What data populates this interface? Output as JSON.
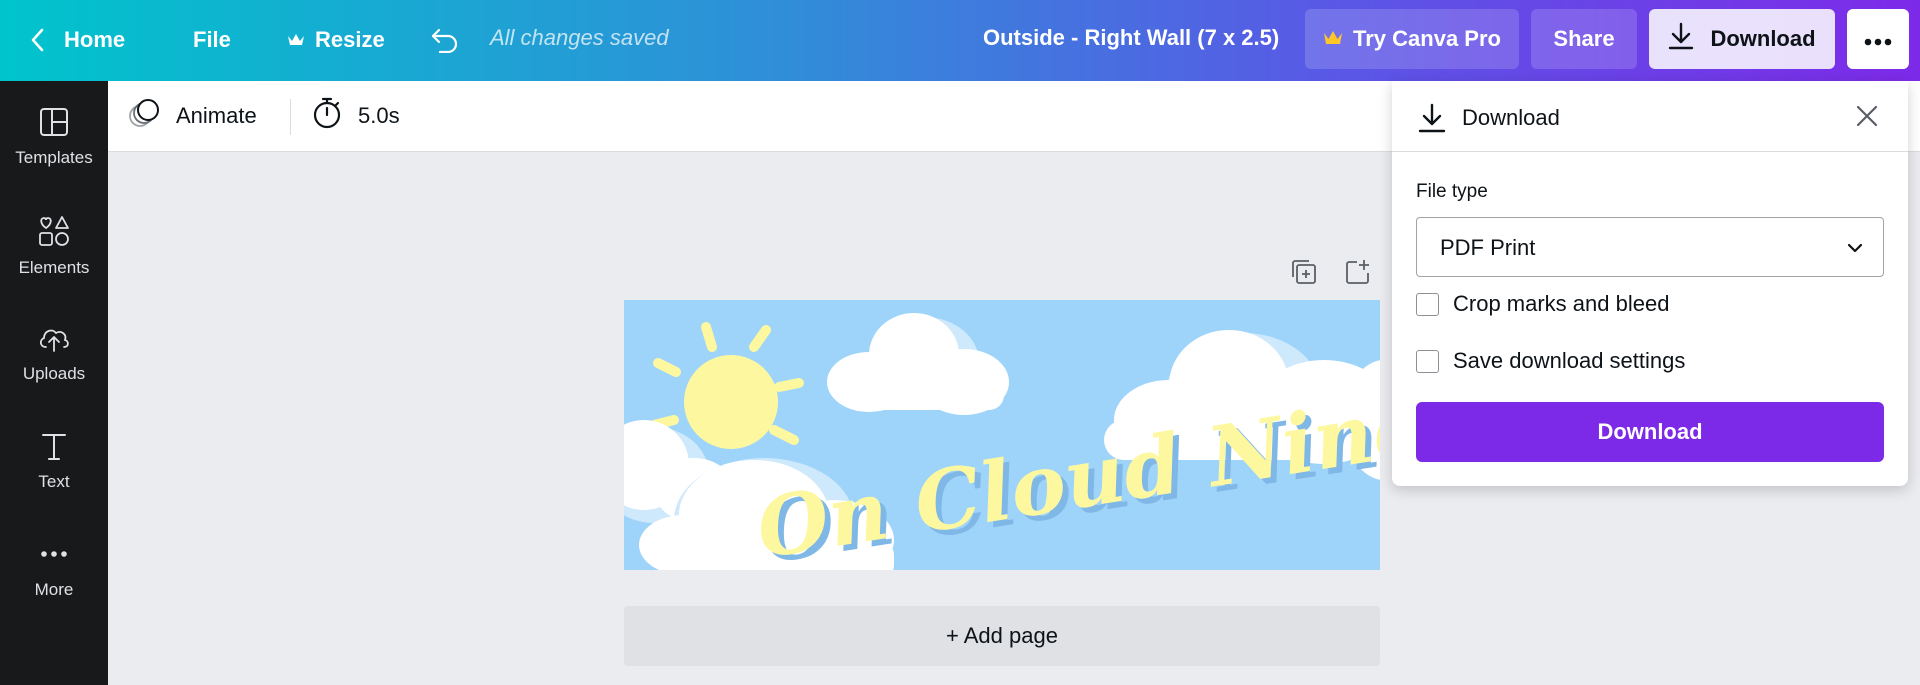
{
  "topbar": {
    "home_label": "Home",
    "file_label": "File",
    "resize_label": "Resize",
    "saved_status": "All changes saved",
    "document_title": "Outside - Right Wall (7 x 2.5)",
    "try_pro_label": "Try Canva Pro",
    "share_label": "Share",
    "download_label": "Download"
  },
  "sidebar": {
    "items": [
      {
        "label": "Templates",
        "icon": "templates-icon"
      },
      {
        "label": "Elements",
        "icon": "elements-icon"
      },
      {
        "label": "Uploads",
        "icon": "uploads-icon"
      },
      {
        "label": "Text",
        "icon": "text-icon"
      },
      {
        "label": "More",
        "icon": "more-icon"
      }
    ]
  },
  "toolbar": {
    "animate_label": "Animate",
    "duration_label": "5.0s"
  },
  "canvas": {
    "design_text": "On Cloud Nine ~",
    "add_page_label": "+ Add page"
  },
  "download_panel": {
    "title": "Download",
    "file_type_label": "File type",
    "file_type_value": "PDF Print",
    "crop_marks_label": "Crop marks and bleed",
    "crop_marks_checked": false,
    "save_settings_label": "Save download settings",
    "save_settings_checked": false,
    "download_button_label": "Download"
  },
  "colors": {
    "brand_purple": "#7d2ae8",
    "gradient_start": "#00c4cc",
    "gradient_end": "#7d2ae8",
    "sidebar_bg": "#18191b",
    "sky": "#9fd4fa",
    "sun": "#fdf8a0"
  }
}
